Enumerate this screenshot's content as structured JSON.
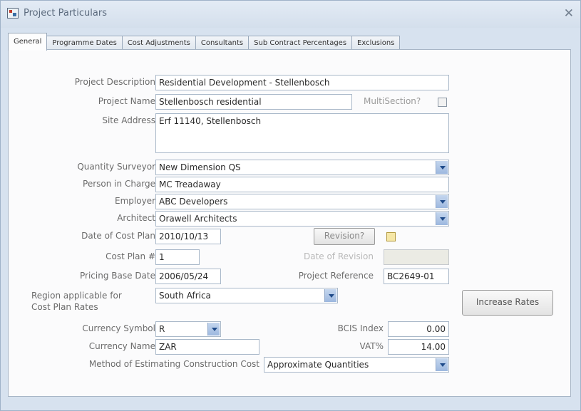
{
  "window": {
    "title": "Project Particulars",
    "close_icon": "close-icon"
  },
  "tabs": [
    {
      "label": "General",
      "active": true
    },
    {
      "label": "Programme Dates"
    },
    {
      "label": "Cost Adjustments"
    },
    {
      "label": "Consultants"
    },
    {
      "label": "Sub Contract Percentages"
    },
    {
      "label": "Exclusions"
    }
  ],
  "general": {
    "project_description": {
      "label": "Project Description",
      "value": "Residential Development - Stellenbosch"
    },
    "project_name": {
      "label": "Project Name",
      "value": "Stellenbosch residential"
    },
    "multisection": {
      "label": "MultiSection?",
      "checked": false
    },
    "site_address": {
      "label": "Site Address",
      "value": "Erf 11140, Stellenbosch"
    },
    "quantity_surveyor": {
      "label": "Quantity Surveyor",
      "value": "New Dimension QS"
    },
    "person_in_charge": {
      "label": "Person in Charge",
      "value": "MC Treadaway"
    },
    "employer": {
      "label": "Employer",
      "value": "ABC Developers"
    },
    "architect": {
      "label": "Architect",
      "value": "Orawell Architects"
    },
    "date_of_cost_plan": {
      "label": "Date of Cost Plan",
      "value": "2010/10/13"
    },
    "revision": {
      "label": "Revision?"
    },
    "cost_plan_no": {
      "label": "Cost Plan #",
      "value": "1"
    },
    "date_of_revision": {
      "label": "Date of Revision",
      "value": ""
    },
    "pricing_base_date": {
      "label": "Pricing Base Date",
      "value": "2006/05/24"
    },
    "project_reference": {
      "label": "Project Reference",
      "value": "BC2649-01"
    },
    "region": {
      "label_line1": "Region applicable for",
      "label_line2": "Cost Plan Rates",
      "value": "South Africa"
    },
    "increase_rates": {
      "label": "Increase Rates"
    },
    "currency_symbol": {
      "label": "Currency Symbol",
      "value": "R"
    },
    "bcis_index": {
      "label": "BCIS Index",
      "value": "0.00"
    },
    "currency_name": {
      "label": "Currency Name",
      "value": "ZAR"
    },
    "vat": {
      "label": "VAT%",
      "value": "14.00"
    },
    "method": {
      "label": "Method of Estimating Construction Cost",
      "value": "Approximate Quantities"
    }
  },
  "colors": {
    "window_bg": "#d7e2ef",
    "panel_bg": "#fbfbfc",
    "dropdown_button": "#9db8df"
  }
}
